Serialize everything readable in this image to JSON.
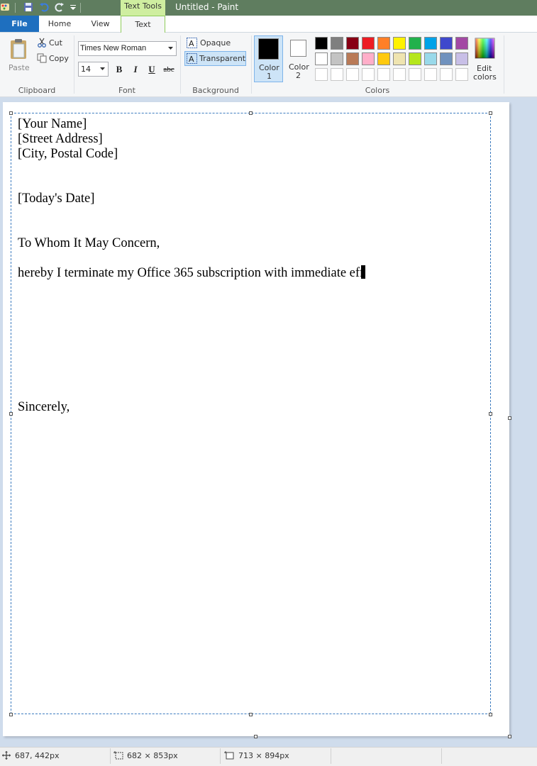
{
  "window": {
    "title": "Untitled - Paint",
    "context_tab_group": "Text Tools"
  },
  "tabs": {
    "file": "File",
    "home": "Home",
    "view": "View",
    "text": "Text"
  },
  "clipboard": {
    "group_label": "Clipboard",
    "paste_label": "Paste",
    "cut_label": "Cut",
    "copy_label": "Copy"
  },
  "font": {
    "group_label": "Font",
    "family_value": "Times New Roman",
    "size_value": "14",
    "bold_label": "B",
    "italic_label": "I",
    "underline_label": "U",
    "strike_label": "abc"
  },
  "background": {
    "group_label": "Background",
    "opaque_label": "Opaque",
    "transparent_label": "Transparent",
    "selected": "Transparent"
  },
  "colors": {
    "group_label": "Colors",
    "color1_label": "Color",
    "color1_num": "1",
    "color1_value": "#000000",
    "color2_label": "Color",
    "color2_num": "2",
    "color2_value": "#ffffff",
    "edit_label_1": "Edit",
    "edit_label_2": "colors",
    "palette_row1": [
      "#000000",
      "#7f7f7f",
      "#880015",
      "#ed1c24",
      "#ff7f27",
      "#fff200",
      "#22b14c",
      "#00a2e8",
      "#3f48cc",
      "#a349a4"
    ],
    "palette_row2": [
      "#ffffff",
      "#c3c3c3",
      "#b97a57",
      "#ffaec9",
      "#ffc90e",
      "#efe4b0",
      "#b5e61d",
      "#99d9ea",
      "#7092be",
      "#c8bfe7"
    ]
  },
  "document": {
    "lines": [
      "[Your Name]",
      "[Street Address]",
      "[City, Postal Code]",
      "[Today's Date]",
      "To Whom It May Concern,",
      "hereby I terminate my Office 365 subscription with immediate eff",
      "Sincerely,"
    ]
  },
  "status": {
    "cursor_pos": "687, 442px",
    "selection_size": "682 × 853px",
    "canvas_size": "713 × 894px"
  },
  "icon_names": [
    "paint-app-icon",
    "save-icon",
    "undo-icon",
    "redo-icon",
    "customize-qat-icon",
    "paste-icon",
    "cut-icon",
    "copy-icon",
    "opaque-icon",
    "transparent-icon",
    "edit-colors-icon",
    "cursor-position-icon",
    "selection-size-icon",
    "canvas-size-icon"
  ]
}
